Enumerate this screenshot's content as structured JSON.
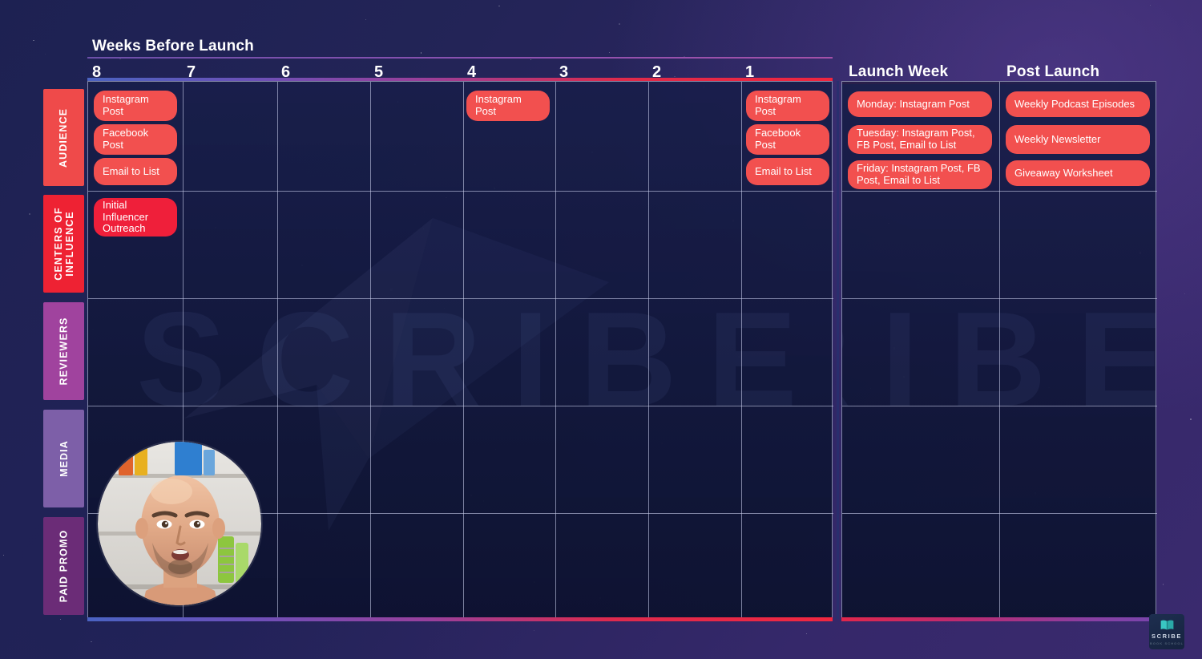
{
  "headers": {
    "weeks_before_launch": "Weeks Before Launch",
    "launch_week": "Launch Week",
    "post_launch": "Post Launch"
  },
  "week_columns": [
    "8",
    "7",
    "6",
    "5",
    "4",
    "3",
    "2",
    "1"
  ],
  "row_labels": [
    {
      "label": "AUDIENCE",
      "color": "#ef4a4a"
    },
    {
      "label": "CENTERS OF\nINFLUENCE",
      "line1": "CENTERS OF",
      "line2": "INFLUENCE",
      "color": "#ee2233"
    },
    {
      "label": "REVIEWERS",
      "color": "#a0439e"
    },
    {
      "label": "MEDIA",
      "color": "#7d5fa8"
    },
    {
      "label": "PAID PROMO",
      "color": "#6b2c77"
    }
  ],
  "cards": {
    "w8_audience": [
      "Instagram Post",
      "Facebook Post",
      "Email to List"
    ],
    "w8_centers": [
      "Initial Influencer Outreach"
    ],
    "w4_audience": [
      "Instagram Post"
    ],
    "w1_audience": [
      "Instagram Post",
      "Facebook Post",
      "Email to List"
    ],
    "launch_week_audience": [
      "Monday: Instagram Post",
      "Tuesday: Instagram Post, FB Post, Email to List",
      "Friday: Instagram Post, FB Post, Email to List"
    ],
    "post_launch_audience": [
      "Weekly Podcast Episodes",
      "Weekly Newsletter",
      "Giveaway Worksheet"
    ]
  },
  "card_text": {
    "instagram_post": "Instagram Post",
    "facebook_post": "Facebook Post",
    "email_to_list": "Email to List",
    "initial_influencer_outreach": "Initial Influencer Outreach",
    "monday": "Monday: Instagram Post",
    "tuesday": "Tuesday: Instagram Post, FB Post, Email to List",
    "friday": "Friday: Instagram Post, FB Post, Email to List",
    "podcast": "Weekly Podcast Episodes",
    "newsletter": "Weekly Newsletter",
    "giveaway": "Giveaway Worksheet"
  },
  "watermark": {
    "text": "SCRIBE"
  },
  "logo": {
    "word": "SCRIBE",
    "sub": "BOOK SCHOOL",
    "icon": "open-book-icon"
  },
  "colors": {
    "card_red": "#f2504f",
    "card_red_bright": "#ef1f3a",
    "grid_line": "#ccd1ef",
    "text_white": "#ffffff",
    "audience_tab": "#ef4a4a",
    "centers_tab": "#ee2233",
    "reviewers_tab": "#a0439e",
    "media_tab": "#7d5fa8",
    "paid_promo_tab": "#6b2c77",
    "accent_purple": "#8b51b0",
    "accent_red": "#f0263f",
    "background": "#232457"
  }
}
